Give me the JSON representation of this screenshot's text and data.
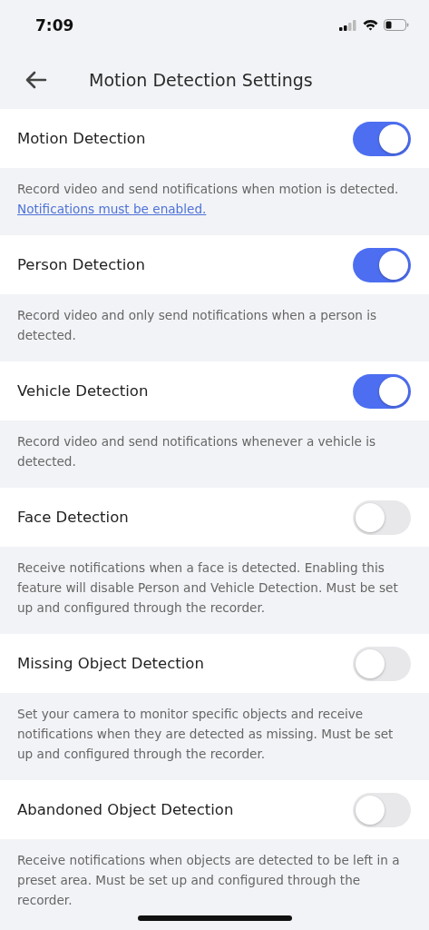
{
  "status_bar": {
    "time": "7:09"
  },
  "header": {
    "title": "Motion Detection Settings"
  },
  "settings": [
    {
      "label": "Motion Detection",
      "on": true,
      "description": "Record video and send notifications when motion is detected.",
      "link": "Notifications must be enabled."
    },
    {
      "label": "Person Detection",
      "on": true,
      "description": "Record video and only send notifications when a person is detected."
    },
    {
      "label": "Vehicle Detection",
      "on": true,
      "description": "Record video and send notifications whenever a vehicle is detected."
    },
    {
      "label": "Face Detection",
      "on": false,
      "description": "Receive notifications when a face is detected. Enabling this feature will disable Person and Vehicle Detection. Must be set up and configured through the recorder."
    },
    {
      "label": "Missing Object Detection",
      "on": false,
      "description": "Set your camera to monitor specific objects and receive notifications when they are detected as missing. Must be set up and configured through the recorder."
    },
    {
      "label": "Abandoned Object Detection",
      "on": false,
      "description": "Receive notifications when objects are detected to be left in a preset area. Must be set up and configured through the recorder."
    }
  ]
}
